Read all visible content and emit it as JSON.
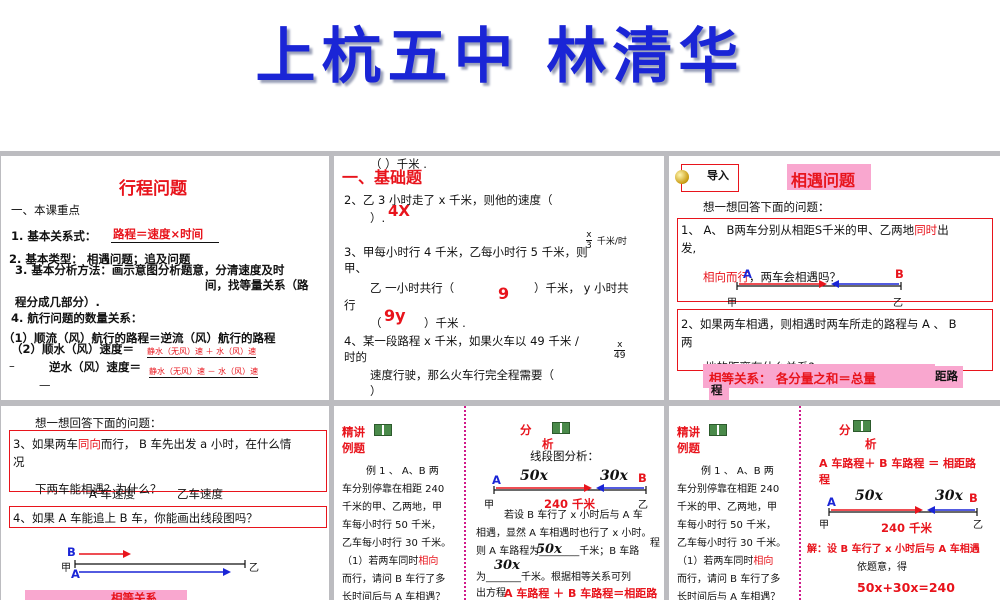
{
  "header": {
    "title": "上杭五中  林清华"
  },
  "panel_tl": {
    "heading": "行程问题",
    "sec1": "一、本课重点",
    "l1_label": "1. 基本关系式：",
    "l1_formula": "路程＝速度×时间",
    "l2": "2. 基本类型： 相遇问题；追及问题",
    "l3a": "3. 基本分析方法：画示意图分析题意，分清速度及时",
    "l3b": "间，找等量关系（路",
    "l3c": "程分成几部分）.",
    "l4": "4. 航行问题的数量关系：",
    "l5": "（1）顺流（风）航行的路程＝逆流（风）航行的路程",
    "l6_label": "（2）顺水（风）速度＝",
    "l6_formula": "静水（无风）速 ＋ 水（风）速",
    "l7_label": "逆水（风）速度＝",
    "l7_formula": "静水（无风）速 － 水（风）速",
    "dash1": "–",
    "dash2": "—"
  },
  "panel_tm": {
    "paren_top": "（        ）千米 .",
    "sec": "一、基础题",
    "q2a": "2、乙 3 小时走了 x 千米，则他的速度（",
    "q2b": "）.",
    "ans_4x": "4X",
    "frac_num": "x",
    "frac_den": "3",
    "frac_unit": "千米/时",
    "q3a": "3、甲每小时行 4 千米，乙每小时行 5 千米，则",
    "q3b": "甲、",
    "q3c": "乙 一小时共行（",
    "q3d": "）千米， y 小时共",
    "q3e": "行",
    "ans_9": "9",
    "q3f": "（",
    "ans_9y": "9y",
    "q3g": "）千米 .",
    "q4a": "4、某一段路程  x  千米，如果火车以 49 千米 /",
    "q4b": "时的",
    "q4c": "速度行驶，那么火车行完全程需要（",
    "q4d": "）",
    "frac2_num": "x",
    "frac2_den": "49"
  },
  "panel_tr": {
    "intro_label": "导入",
    "heading": "相遇问题",
    "think": "想一想回答下面的问题：",
    "q1a_pre": "1、 A、 B两车分别从相距S千米的甲、乙两地",
    "q1a_red": "同时",
    "q1a_post": "出",
    "q1b": "发,",
    "q1c_red": "相向而行",
    "q1c": "，两车会相遇吗？",
    "pt_a": "A",
    "pt_b": "B",
    "loc_jia": "甲",
    "loc_yi": "乙",
    "q2a": "2、如果两车相遇，则相遇时两车所走的路程与 A 、 B",
    "q2b": "两",
    "q2c": "地的距离有什么关系?",
    "eq": "相等关系： 各分量之和＝总量",
    "side1": "距路",
    "side2": "程"
  },
  "panel_bl": {
    "think": "想一想回答下面的问题：",
    "q3a_pre": "3、如果两车",
    "q3a_red": "同向",
    "q3a_post": "而行， B 车先出发 a 小时，在什么情",
    "q3b": "况",
    "q3c": "下两车能相遇？为什么？",
    "q3d": "A 车速度",
    "q3e": "乙车速度",
    "q4": "4、如果 A 车能追上 B 车，你能画出线段图吗？",
    "pt_b": "B",
    "pt_a": "A",
    "loc_jia": "甲",
    "loc_yi": "乙",
    "bottom": "相等关系"
  },
  "panel_bm": {
    "lecture": "精讲",
    "example": "例题",
    "analysis": "分",
    "analysis2": "析",
    "ex1": "例 1 、 A、B 两",
    "ex2": "车分别停靠在相距 240",
    "ex3": "千米的甲、乙两地，甲",
    "ex4": "车每小时行 50 千米，",
    "ex5": "乙车每小时行 30 千米。",
    "ex6_pre": "（1）若两车同时",
    "ex6_red": "相向",
    "ex7": "而行，请问 B 车行了多",
    "ex8": "长时间后与 A 车相遇？",
    "seg_title": "线段图分析：",
    "seg_a": "A",
    "seg_b": "B",
    "seg_50x": "50x",
    "seg_30x": "30x",
    "seg_240": "240 千米",
    "seg_jia": "甲",
    "seg_yi": "乙",
    "r1": "若设 B 车行了 x 小时后与 A 车",
    "r2": "相遇，显然 A 车相遇时也行了 x 小时。",
    "r3": "则 A 车路程为________千米；B 车路",
    "r3b": "程",
    "r3_50x": "50x",
    "r4_30x": "30x",
    "r4": "为_______千米。根据相等关系可列",
    "r5": "出方程",
    "r5_eq": "A 车路程 ＋ B 车路程＝相距路"
  },
  "panel_br": {
    "lecture": "精讲",
    "example": "例题",
    "analysis": "分",
    "analysis2": "析",
    "ex1": "例 1 、 A、B 两",
    "ex2": "车分别停靠在相距 240",
    "ex3": "千米的甲、乙两地，甲",
    "ex4": "车每小时行 50 千米，",
    "ex5": "乙车每小时行 30 千米。",
    "ex6_pre": "（1）若两车同时",
    "ex6_red": "相向",
    "ex7": "而行，请问 B 车行了多",
    "ex8": "长时间后与 A 车相遇？",
    "rel1": "A 车路程＋ B 车路程  ＝  相距路",
    "rel2": "程",
    "seg_a": "A",
    "seg_b": "B",
    "seg_50x": "50x",
    "seg_30x": "30x",
    "seg_240": "240 千米",
    "seg_jia": "甲",
    "seg_yi": "乙",
    "sol1": "解：设 B 车行了 x 小时后与 A 车相遇",
    "sol2": "依题意，得",
    "sol_eq": "50x+30x=240"
  },
  "colors": {
    "title_blue": "#1a25d6",
    "red": "#e8141c",
    "pink": "#f9a7cf",
    "divider": "#d01a8a"
  }
}
